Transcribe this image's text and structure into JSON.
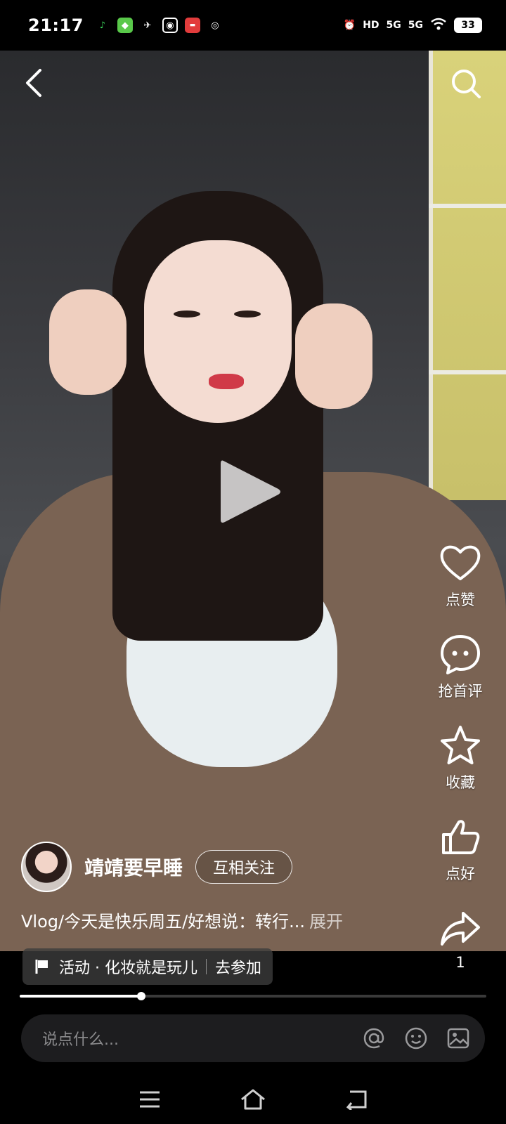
{
  "status_bar": {
    "time": "21:17",
    "apps": [
      "music-icon",
      "game-icon",
      "bird-icon",
      "camera-icon",
      "news-icon",
      "weibo-icon"
    ],
    "right": [
      "alarm-icon",
      "HD",
      "5G",
      "5G",
      "wifi-icon"
    ],
    "battery": "33"
  },
  "video": {
    "state": "paused"
  },
  "rail": {
    "like_label": "点赞",
    "comment_label": "抢首评",
    "collect_label": "收藏",
    "good_label": "点好",
    "share_count": "1"
  },
  "author": {
    "name": "靖靖要早睡",
    "follow_label": "互相关注"
  },
  "caption": {
    "text": "Vlog/今天是快乐周五/好想说：转行...",
    "expand": "展开"
  },
  "activity": {
    "label": "活动 · 化妆就是玩儿",
    "action": "去参加"
  },
  "progress": {
    "fraction": 0.26
  },
  "comment": {
    "placeholder": "说点什么..."
  },
  "colors": {
    "background": "#000000",
    "comment_bar": "#1d1d1f",
    "placeholder": "#8b8b8d"
  }
}
